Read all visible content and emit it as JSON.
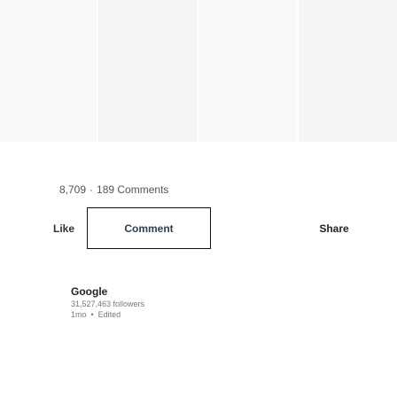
{
  "social": {
    "reactions": "8,709",
    "separator": "·",
    "comments": "189 Comments"
  },
  "actions": {
    "like": "Like",
    "comment": "Comment",
    "share": "Share"
  },
  "author": {
    "name": "Google",
    "followers": "31,527,463 followers",
    "time": "1mo",
    "meta_separator": "•",
    "edited": "Edited"
  }
}
